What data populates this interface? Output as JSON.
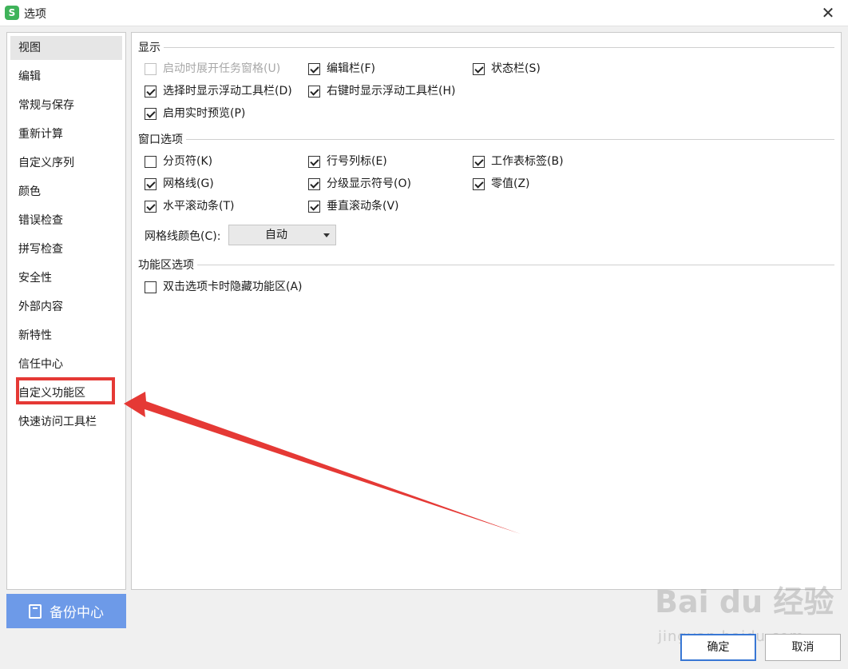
{
  "window": {
    "app_icon": "S",
    "title": "选项",
    "close_glyph": "✕"
  },
  "sidebar": {
    "items": [
      {
        "label": "视图"
      },
      {
        "label": "编辑"
      },
      {
        "label": "常规与保存"
      },
      {
        "label": "重新计算"
      },
      {
        "label": "自定义序列"
      },
      {
        "label": "颜色"
      },
      {
        "label": "错误检查"
      },
      {
        "label": "拼写检查"
      },
      {
        "label": "安全性"
      },
      {
        "label": "外部内容"
      },
      {
        "label": "新特性"
      },
      {
        "label": "信任中心"
      },
      {
        "label": "自定义功能区"
      },
      {
        "label": "快速访问工具栏"
      }
    ],
    "active_item": "视图",
    "backup_button": "备份中心"
  },
  "display": {
    "title": "显示",
    "options": [
      {
        "label": "启动时展开任务窗格(U)",
        "checked": false,
        "disabled": true
      },
      {
        "label": "编辑栏(F)",
        "checked": true
      },
      {
        "label": "状态栏(S)",
        "checked": true
      },
      {
        "label": "选择时显示浮动工具栏(D)",
        "checked": true
      },
      {
        "label": "右键时显示浮动工具栏(H)",
        "checked": true
      },
      {
        "label": "启用实时预览(P)",
        "checked": true
      }
    ]
  },
  "window_options": {
    "title": "窗口选项",
    "options": [
      {
        "label": "分页符(K)",
        "checked": false
      },
      {
        "label": "行号列标(E)",
        "checked": true
      },
      {
        "label": "工作表标签(B)",
        "checked": true
      },
      {
        "label": "网格线(G)",
        "checked": true
      },
      {
        "label": "分级显示符号(O)",
        "checked": true
      },
      {
        "label": "零值(Z)",
        "checked": true
      },
      {
        "label": "水平滚动条(T)",
        "checked": true
      },
      {
        "label": "垂直滚动条(V)",
        "checked": true
      }
    ],
    "gridline_color_label": "网格线颜色(C):",
    "gridline_color_value": "自动"
  },
  "ribbon_options": {
    "title": "功能区选项",
    "options": [
      {
        "label": "双击选项卡时隐藏功能区(A)",
        "checked": false
      }
    ]
  },
  "buttons": {
    "ok": "确定",
    "cancel": "取消"
  },
  "watermark": {
    "main": "Bai du 经验",
    "sub": "jingyan.baidu.com"
  },
  "annotation": {
    "highlight_color": "#e53935",
    "arrow_color": "#e53935"
  }
}
